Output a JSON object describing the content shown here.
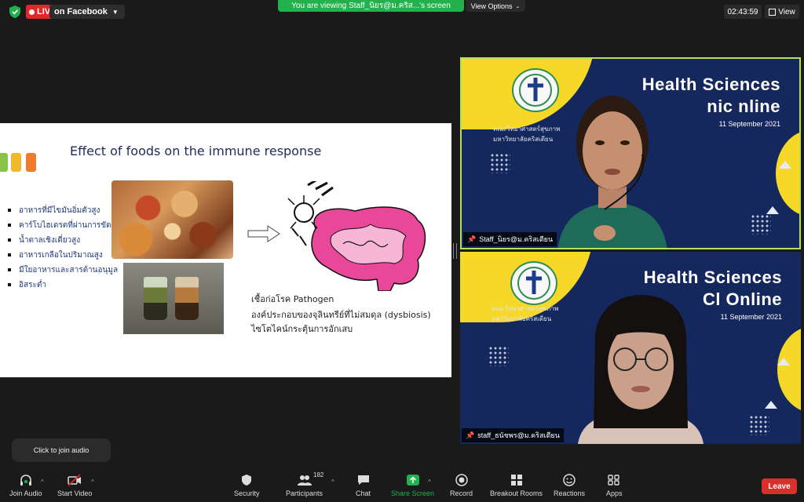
{
  "topbar": {
    "live_label": "LIVE",
    "live_target": "on Facebook",
    "viewing_text": "You are viewing Staff_นิยร@ม.คริส...'s screen",
    "view_options": "View Options",
    "timer": "02:43:59",
    "view_label": "View"
  },
  "slide": {
    "title": "Effect of foods on the immune response",
    "color_squares": [
      "#8bc34a",
      "#f1b82d",
      "#f07b2a"
    ],
    "bullets": [
      "อาหารที่มีไขมันอิ่มตัวสูง",
      "คาร์โบไฮเดรตที่ผ่านการขัดสี",
      "น้ำตาลเชิงเดี่ยวสูง",
      "อาหารเกลือในปริมาณสูง",
      "มีใยอาหารและสารต้านอนุมูล",
      "อิสระต่ำ"
    ],
    "desc_lines": [
      "เชื้อก่อโรค Pathogen",
      "องค์ประกอบของจุลินทรีย์ที่ไม่สมดุล (dysbiosis)",
      "ไซโตไคน์กระตุ้นการอักเสบ"
    ]
  },
  "tiles": [
    {
      "banner_line1": "Health Sciences",
      "banner_line2": "nic  nline",
      "date": "11 September 2021",
      "uni_line1": "คณะวิทยาศาสตร์สุขภาพ",
      "uni_line2": "มหาวิทยาลัยคริสเตียน",
      "name": "Staff_นิยร@ม.คริสเตียน"
    },
    {
      "banner_line1": "Health Sciences",
      "banner_line2": "Cl     Online",
      "date": "11 September 2021",
      "uni_line1": "คณะวิทยาศาสตร์สุขภาพ",
      "uni_line2": "มหาวิทยาลัยคริสเตียน",
      "name": "staff_ธนัชพร@ม.คริสเตียน"
    }
  ],
  "tooltip": "Click to join audio",
  "toolbar": {
    "join_audio": "Join Audio",
    "start_video": "Start Video",
    "security": "Security",
    "participants": "Participants",
    "participants_count": "182",
    "chat": "Chat",
    "share_screen": "Share Screen",
    "record": "Record",
    "breakout_rooms": "Breakout Rooms",
    "reactions": "Reactions",
    "apps": "Apps",
    "leave": "Leave"
  },
  "colors": {
    "live_red": "#e02828",
    "share_green": "#22b14c",
    "leave_red": "#d8302b",
    "active_speaker_border": "#b6e05a"
  }
}
